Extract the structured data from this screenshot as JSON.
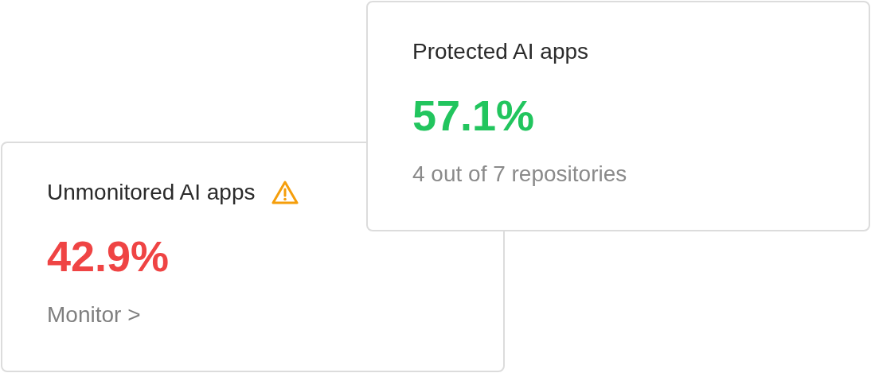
{
  "cards": [
    {
      "title": "Unmonitored AI apps",
      "warning": true,
      "value": "42.9%",
      "color": "#ef4444",
      "kind": "link",
      "footer": "Monitor >"
    },
    {
      "title": "Protected AI apps",
      "warning": false,
      "value": "57.1%",
      "color": "#22c55e",
      "kind": "note",
      "footer": "4 out of 7 repositories"
    }
  ]
}
